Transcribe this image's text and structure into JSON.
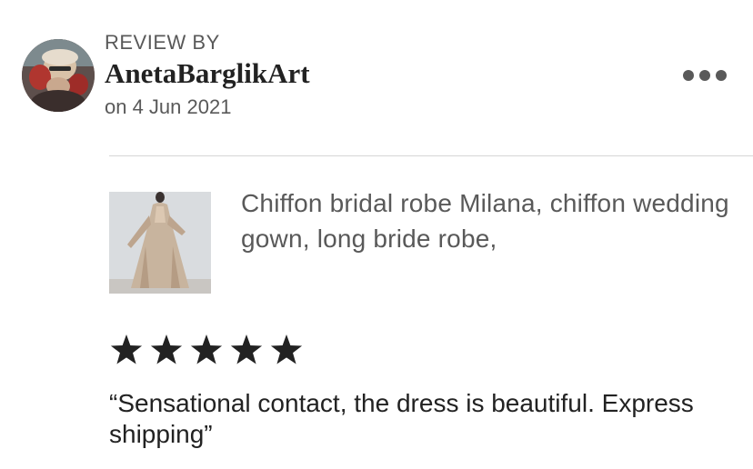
{
  "review": {
    "header_label": "REVIEW BY",
    "username": "AnetaBarglikArt",
    "date": "on 4 Jun 2021",
    "more_icon": "more-horizontal-icon",
    "product_title": "Chiffon bridal robe Milana, chiffon wedding gown, long bride robe,",
    "rating": 5,
    "rating_max": 5,
    "text": "“Sensational contact, the dress is beautiful. Express shipping”"
  },
  "colors": {
    "primary_text": "#222222",
    "secondary_text": "#595959",
    "divider": "#d6d6d6",
    "star": "#222222"
  }
}
